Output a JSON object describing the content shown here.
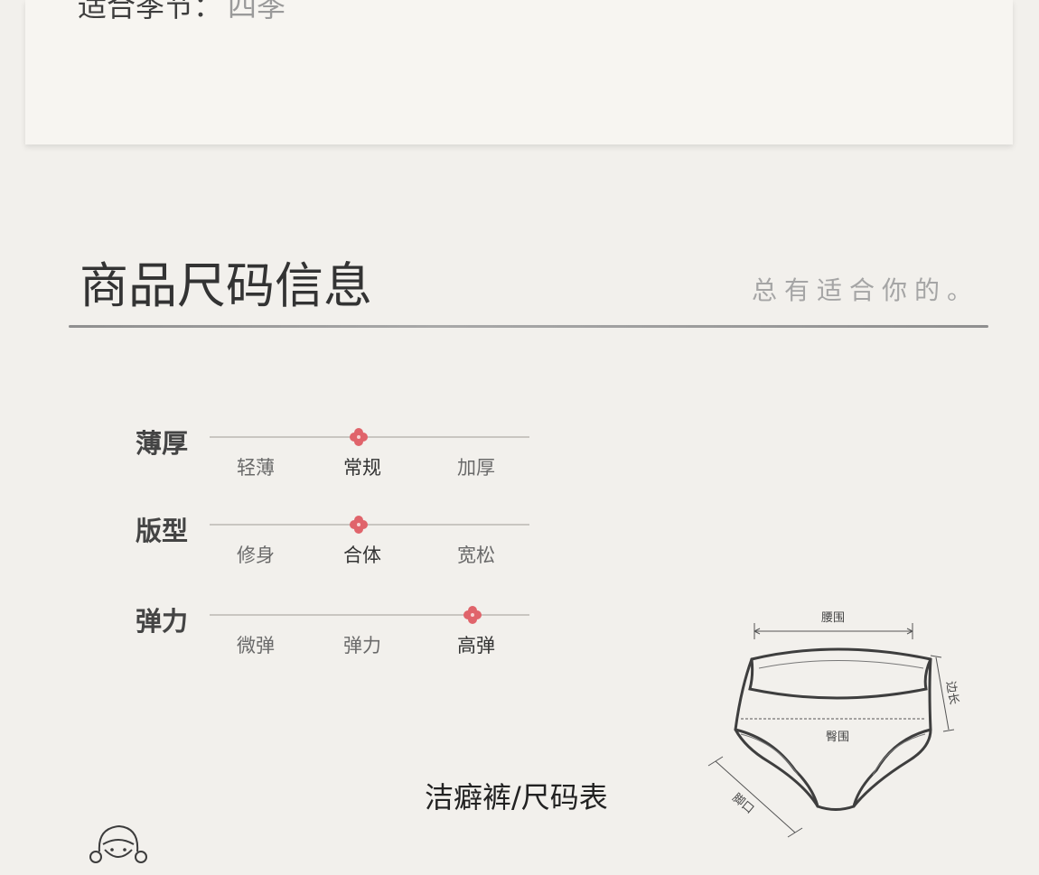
{
  "season": {
    "label": "适合季节：",
    "value": "四季"
  },
  "section": {
    "title": "商品尺码信息",
    "subtitle": "总有适合你的。"
  },
  "attributes": [
    {
      "name": "薄厚",
      "options": [
        "轻薄",
        "常规",
        "加厚"
      ],
      "selected_index": 1
    },
    {
      "name": "版型",
      "options": [
        "修身",
        "合体",
        "宽松"
      ],
      "selected_index": 1
    },
    {
      "name": "弹力",
      "options": [
        "微弹",
        "弹力",
        "高弹"
      ],
      "selected_index": 2
    }
  ],
  "diagram": {
    "labels": {
      "waist": "腰围",
      "side": "边长",
      "hip": "臀围",
      "leg": "脚口"
    }
  },
  "size_table_title": "洁癖裤/尺码表",
  "colors": {
    "marker": "#e0646b",
    "background": "#f2f0ec",
    "card": "#f7f5f1"
  },
  "icons": [
    "flower-marker-icon",
    "underwear-diagram",
    "girl-mascot-icon"
  ]
}
